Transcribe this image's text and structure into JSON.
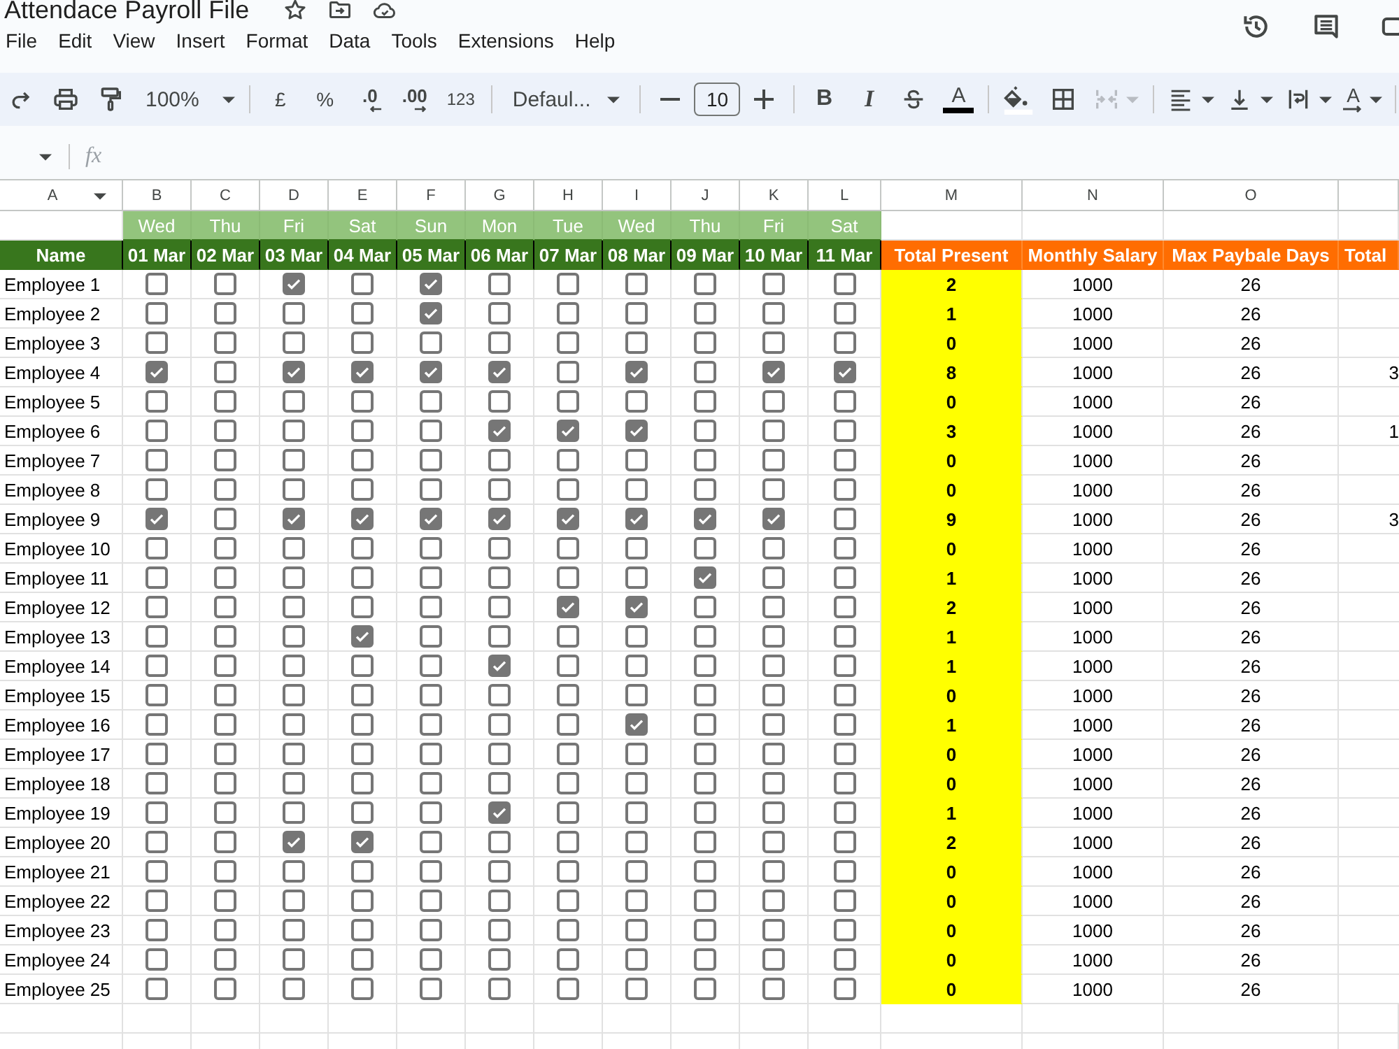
{
  "document": {
    "title": "Attendace Payroll File"
  },
  "menu_bar": [
    "File",
    "Edit",
    "View",
    "Insert",
    "Format",
    "Data",
    "Tools",
    "Extensions",
    "Help"
  ],
  "toolbar": {
    "zoom": "100%",
    "currency": "£",
    "percent": "%",
    "decrease_decimals": ".0",
    "increase_decimals": ".00",
    "number_format": "123",
    "font": "Defaul...",
    "font_size": "10",
    "bold": "B",
    "italic": "I",
    "text_color": "A",
    "text_rotation": "A",
    "merge_disabled": true
  },
  "formula_bar": {
    "label": "fx"
  },
  "sheet": {
    "columns": [
      {
        "letter": "A",
        "hovered": true
      },
      {
        "letter": "B",
        "hovered": false
      },
      {
        "letter": "C",
        "hovered": false
      },
      {
        "letter": "D",
        "hovered": false
      },
      {
        "letter": "E",
        "hovered": false
      },
      {
        "letter": "F",
        "hovered": false
      },
      {
        "letter": "G",
        "hovered": false
      },
      {
        "letter": "H",
        "hovered": false
      },
      {
        "letter": "I",
        "hovered": false
      },
      {
        "letter": "J",
        "hovered": false
      },
      {
        "letter": "K",
        "hovered": false
      },
      {
        "letter": "L",
        "hovered": false
      },
      {
        "letter": "M",
        "hovered": false
      },
      {
        "letter": "N",
        "hovered": false
      },
      {
        "letter": "O",
        "hovered": false
      }
    ],
    "day_row": [
      "Wed",
      "Thu",
      "Fri",
      "Sat",
      "Sun",
      "Mon",
      "Tue",
      "Wed",
      "Thu",
      "Fri",
      "Sat"
    ],
    "header_row": [
      {
        "text": "Name",
        "kind": "name"
      },
      {
        "text": "01 Mar",
        "kind": "date"
      },
      {
        "text": "02 Mar",
        "kind": "date"
      },
      {
        "text": "03 Mar",
        "kind": "date"
      },
      {
        "text": "04 Mar",
        "kind": "date"
      },
      {
        "text": "05 Mar",
        "kind": "date"
      },
      {
        "text": "06 Mar",
        "kind": "date"
      },
      {
        "text": "07 Mar",
        "kind": "date"
      },
      {
        "text": "08 Mar",
        "kind": "date"
      },
      {
        "text": "09 Mar",
        "kind": "date"
      },
      {
        "text": "10 Mar",
        "kind": "date"
      },
      {
        "text": "11 Mar",
        "kind": "date"
      },
      {
        "text": "Total Present",
        "kind": "summary"
      },
      {
        "text": "Monthly Salary",
        "kind": "summary"
      },
      {
        "text": "Max Paybale Days",
        "kind": "summary"
      },
      {
        "text": "Total",
        "kind": "summary"
      }
    ],
    "rows": [
      {
        "name": "Employee 1",
        "attendance": [
          false,
          false,
          true,
          false,
          true,
          false,
          false,
          false,
          false,
          false,
          false
        ],
        "total_present": "2",
        "monthly_salary": "1000",
        "max_payable_days": "26"
      },
      {
        "name": "Employee 2",
        "attendance": [
          false,
          false,
          false,
          false,
          true,
          false,
          false,
          false,
          false,
          false,
          false
        ],
        "total_present": "1",
        "monthly_salary": "1000",
        "max_payable_days": "26"
      },
      {
        "name": "Employee 3",
        "attendance": [
          false,
          false,
          false,
          false,
          false,
          false,
          false,
          false,
          false,
          false,
          false
        ],
        "total_present": "0",
        "monthly_salary": "1000",
        "max_payable_days": "26"
      },
      {
        "name": "Employee 4",
        "attendance": [
          true,
          false,
          true,
          true,
          true,
          true,
          false,
          true,
          false,
          true,
          true
        ],
        "total_present": "8",
        "monthly_salary": "1000",
        "max_payable_days": "26",
        "column_16": "3"
      },
      {
        "name": "Employee 5",
        "attendance": [
          false,
          false,
          false,
          false,
          false,
          false,
          false,
          false,
          false,
          false,
          false
        ],
        "total_present": "0",
        "monthly_salary": "1000",
        "max_payable_days": "26"
      },
      {
        "name": "Employee 6",
        "attendance": [
          false,
          false,
          false,
          false,
          false,
          true,
          true,
          true,
          false,
          false,
          false
        ],
        "total_present": "3",
        "monthly_salary": "1000",
        "max_payable_days": "26",
        "column_16": "1"
      },
      {
        "name": "Employee 7",
        "attendance": [
          false,
          false,
          false,
          false,
          false,
          false,
          false,
          false,
          false,
          false,
          false
        ],
        "total_present": "0",
        "monthly_salary": "1000",
        "max_payable_days": "26"
      },
      {
        "name": "Employee 8",
        "attendance": [
          false,
          false,
          false,
          false,
          false,
          false,
          false,
          false,
          false,
          false,
          false
        ],
        "total_present": "0",
        "monthly_salary": "1000",
        "max_payable_days": "26"
      },
      {
        "name": "Employee 9",
        "attendance": [
          true,
          false,
          true,
          true,
          true,
          true,
          true,
          true,
          true,
          true,
          false
        ],
        "total_present": "9",
        "monthly_salary": "1000",
        "max_payable_days": "26",
        "column_16": "3"
      },
      {
        "name": "Employee 10",
        "attendance": [
          false,
          false,
          false,
          false,
          false,
          false,
          false,
          false,
          false,
          false,
          false
        ],
        "total_present": "0",
        "monthly_salary": "1000",
        "max_payable_days": "26"
      },
      {
        "name": "Employee 11",
        "attendance": [
          false,
          false,
          false,
          false,
          false,
          false,
          false,
          false,
          true,
          false,
          false
        ],
        "total_present": "1",
        "monthly_salary": "1000",
        "max_payable_days": "26"
      },
      {
        "name": "Employee 12",
        "attendance": [
          false,
          false,
          false,
          false,
          false,
          false,
          true,
          true,
          false,
          false,
          false
        ],
        "total_present": "2",
        "monthly_salary": "1000",
        "max_payable_days": "26"
      },
      {
        "name": "Employee 13",
        "attendance": [
          false,
          false,
          false,
          true,
          false,
          false,
          false,
          false,
          false,
          false,
          false
        ],
        "total_present": "1",
        "monthly_salary": "1000",
        "max_payable_days": "26"
      },
      {
        "name": "Employee 14",
        "attendance": [
          false,
          false,
          false,
          false,
          false,
          true,
          false,
          false,
          false,
          false,
          false
        ],
        "total_present": "1",
        "monthly_salary": "1000",
        "max_payable_days": "26"
      },
      {
        "name": "Employee 15",
        "attendance": [
          false,
          false,
          false,
          false,
          false,
          false,
          false,
          false,
          false,
          false,
          false
        ],
        "total_present": "0",
        "monthly_salary": "1000",
        "max_payable_days": "26"
      },
      {
        "name": "Employee 16",
        "attendance": [
          false,
          false,
          false,
          false,
          false,
          false,
          false,
          true,
          false,
          false,
          false
        ],
        "total_present": "1",
        "monthly_salary": "1000",
        "max_payable_days": "26"
      },
      {
        "name": "Employee 17",
        "attendance": [
          false,
          false,
          false,
          false,
          false,
          false,
          false,
          false,
          false,
          false,
          false
        ],
        "total_present": "0",
        "monthly_salary": "1000",
        "max_payable_days": "26"
      },
      {
        "name": "Employee 18",
        "attendance": [
          false,
          false,
          false,
          false,
          false,
          false,
          false,
          false,
          false,
          false,
          false
        ],
        "total_present": "0",
        "monthly_salary": "1000",
        "max_payable_days": "26"
      },
      {
        "name": "Employee 19",
        "attendance": [
          false,
          false,
          false,
          false,
          false,
          true,
          false,
          false,
          false,
          false,
          false
        ],
        "total_present": "1",
        "monthly_salary": "1000",
        "max_payable_days": "26"
      },
      {
        "name": "Employee 20",
        "attendance": [
          false,
          false,
          true,
          true,
          false,
          false,
          false,
          false,
          false,
          false,
          false
        ],
        "total_present": "2",
        "monthly_salary": "1000",
        "max_payable_days": "26"
      },
      {
        "name": "Employee 21",
        "attendance": [
          false,
          false,
          false,
          false,
          false,
          false,
          false,
          false,
          false,
          false,
          false
        ],
        "total_present": "0",
        "monthly_salary": "1000",
        "max_payable_days": "26"
      },
      {
        "name": "Employee 22",
        "attendance": [
          false,
          false,
          false,
          false,
          false,
          false,
          false,
          false,
          false,
          false,
          false
        ],
        "total_present": "0",
        "monthly_salary": "1000",
        "max_payable_days": "26"
      },
      {
        "name": "Employee 23",
        "attendance": [
          false,
          false,
          false,
          false,
          false,
          false,
          false,
          false,
          false,
          false,
          false
        ],
        "total_present": "0",
        "monthly_salary": "1000",
        "max_payable_days": "26"
      },
      {
        "name": "Employee 24",
        "attendance": [
          false,
          false,
          false,
          false,
          false,
          false,
          false,
          false,
          false,
          false,
          false
        ],
        "total_present": "0",
        "monthly_salary": "1000",
        "max_payable_days": "26"
      },
      {
        "name": "Employee 25",
        "attendance": [
          false,
          false,
          false,
          false,
          false,
          false,
          false,
          false,
          false,
          false,
          false
        ],
        "total_present": "0",
        "monthly_salary": "1000",
        "max_payable_days": "26"
      }
    ]
  }
}
